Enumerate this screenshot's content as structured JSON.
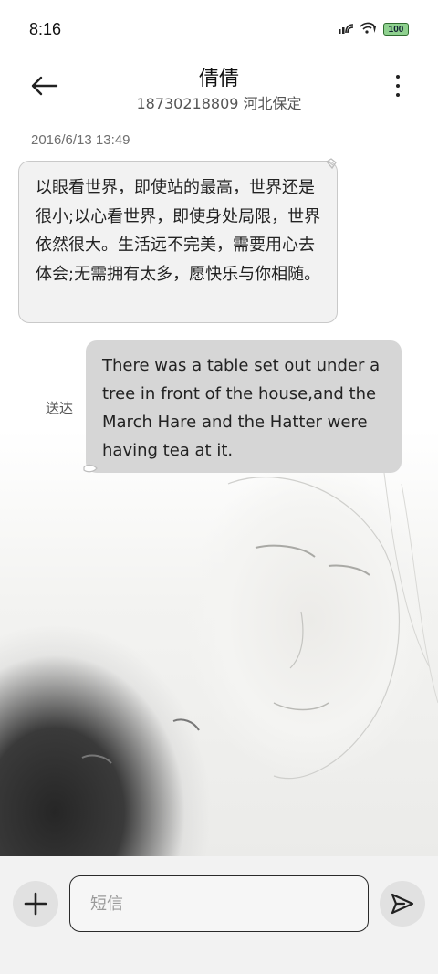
{
  "status_bar": {
    "time": "8:16",
    "battery": "100",
    "icons": [
      "nfc-icon",
      "wifi-icon",
      "battery-icon"
    ]
  },
  "header": {
    "contact_name": "倩倩",
    "contact_sub": "18730218809 河北保定",
    "back_icon": "arrow-left-icon",
    "more_icon": "more-vertical-icon"
  },
  "conversation": {
    "timestamp": "2016/6/13 13:49",
    "messages": [
      {
        "direction": "incoming",
        "text": "以眼看世界，即使站的最高，世界还是很小;以心看世界，即使身处局限，世界依然很大。生活远不完美，需要用心去体会;无需拥有太多，愿快乐与你相随。"
      },
      {
        "direction": "outgoing",
        "status": "送达",
        "text": "There was a table set out under a tree in front of the house,and the March Hare and the Hatter were having tea at it."
      }
    ]
  },
  "composer": {
    "placeholder": "短信",
    "value": "",
    "add_icon": "plus-icon",
    "send_icon": "send-icon"
  },
  "colors": {
    "incoming_bubble": "#f2f2f2",
    "outgoing_bubble": "#d6d6d6",
    "battery_fill": "#8fd18f"
  }
}
